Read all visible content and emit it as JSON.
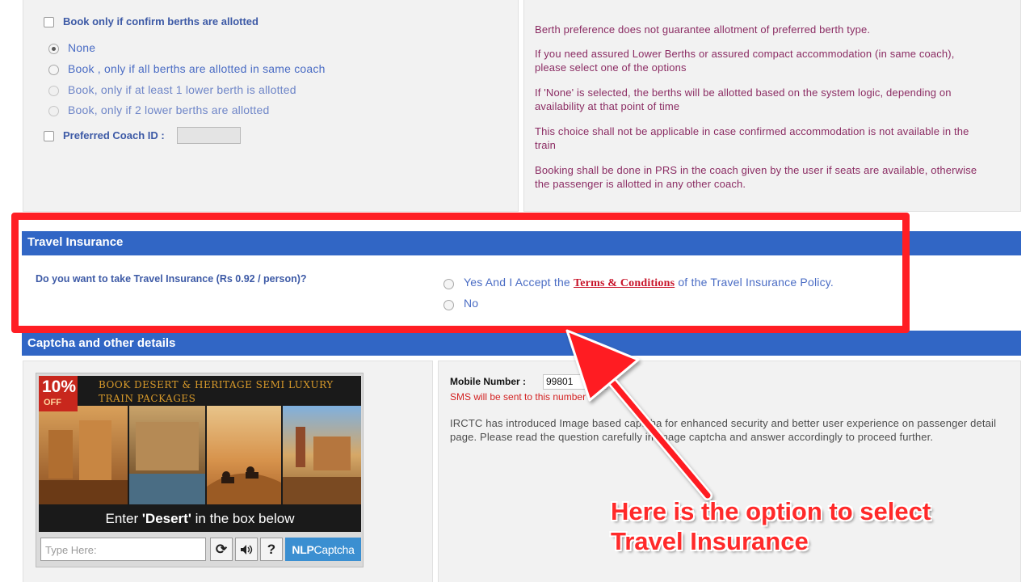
{
  "berth_options": {
    "confirm_only_label": "Book only if confirm berths are allotted",
    "radio_options": [
      {
        "label": "None",
        "selected": true,
        "enabled": true
      },
      {
        "label": "Book , only if all berths are allotted in same coach",
        "selected": false,
        "enabled": true
      },
      {
        "label": "Book, only if at least 1 lower berth is allotted",
        "selected": false,
        "enabled": false
      },
      {
        "label": "Book, only if 2 lower berths are allotted",
        "selected": false,
        "enabled": false
      }
    ],
    "preferred_coach_label": "Preferred Coach ID :",
    "preferred_coach_value": ""
  },
  "berth_info": [
    "Berth preference does not guarantee allotment of preferred berth type.",
    "If you need assured Lower Berths or assured compact accommodation (in same coach), please select one of the options",
    "If 'None' is selected, the berths will be allotted based on the system logic, depending on availability at that point of time",
    "This choice shall not be applicable in case confirmed accommodation is not available in the train",
    "Booking shall be done in PRS in the coach given by the user if seats are available, otherwise the passenger is allotted in any other coach."
  ],
  "travel_insurance": {
    "header": "Travel Insurance",
    "question": "Do you want to take Travel Insurance (Rs 0.92 / person)?",
    "yes_prefix": "Yes And I Accept the ",
    "terms_link": "Terms & Conditions",
    "yes_suffix": " of the Travel Insurance Policy.",
    "no_label": "No"
  },
  "captcha_section": {
    "header": "Captcha and other details",
    "ad": {
      "badge_pct": "10%",
      "badge_off": "OFF",
      "title_line1": "Book Desert & Heritage Semi Luxury",
      "title_line2": "Train packages",
      "instruction_prefix": "Enter ",
      "instruction_keyword": "'Desert'",
      "instruction_suffix": " in the box below"
    },
    "input_placeholder": "Type Here:",
    "brand_prefix": "NLP",
    "brand_suffix": "Captcha",
    "mobile_label": "Mobile Number :",
    "mobile_value": "99801",
    "sms_note": "SMS will be sent to this number",
    "info_text": "IRCTC has introduced Image based captcha for enhanced security and better user experience on passenger detail page. Please read the question carefully in image captcha and answer accordingly to proceed further."
  },
  "annotation": {
    "line1": "Here is the option to select",
    "line2": "Travel Insurance"
  },
  "colors": {
    "header_blue": "#3166c5",
    "highlight_red": "#ff1e24",
    "info_text": "#8b2c63",
    "link_red": "#c8142a"
  },
  "icons": [
    "refresh-icon",
    "audio-icon",
    "help-icon"
  ]
}
